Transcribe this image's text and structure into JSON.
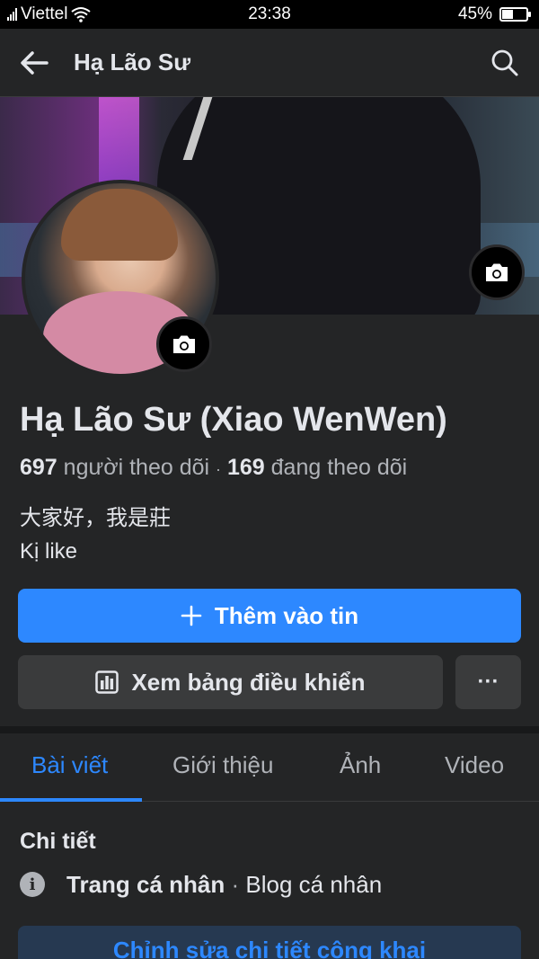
{
  "status_bar": {
    "carrier": "Viettel",
    "time": "23:38",
    "battery_percent": "45%",
    "battery_level": 0.45,
    "icons": [
      "signal-icon",
      "wifi-icon",
      "battery-icon"
    ]
  },
  "header": {
    "title": "Hạ Lão Sư",
    "back_icon": "arrow-left-icon",
    "search_icon": "search-icon"
  },
  "cover": {
    "camera_icon": "camera-icon"
  },
  "profile": {
    "name": "Hạ Lão Sư (Xiao WenWen)",
    "followers_count": "697",
    "followers_label": "người theo dõi",
    "dot": "·",
    "following_count": "169",
    "following_label": "đang theo dõi",
    "bio_line1": "大家好，我是莊",
    "bio_line2": "Kị like"
  },
  "actions": {
    "add_story_label": "Thêm vào tin",
    "add_story_icon": "plus-icon",
    "dashboard_label": "Xem bảng điều khiển",
    "dashboard_icon": "dashboard-icon",
    "more_label": "···"
  },
  "tabs": [
    {
      "label": "Bài viết",
      "active": true
    },
    {
      "label": "Giới thiệu",
      "active": false
    },
    {
      "label": "Ảnh",
      "active": false
    },
    {
      "label": "Video",
      "active": false
    }
  ],
  "details": {
    "title": "Chi tiết",
    "page_type": "Trang cá nhân",
    "separator": "·",
    "category": "Blog cá nhân",
    "info_icon_glyph": "i",
    "edit_button_label": "Chỉnh sửa chi tiết công khai"
  },
  "colors": {
    "accent": "#2d88ff",
    "background": "#242526",
    "button_secondary": "#3a3b3c"
  }
}
